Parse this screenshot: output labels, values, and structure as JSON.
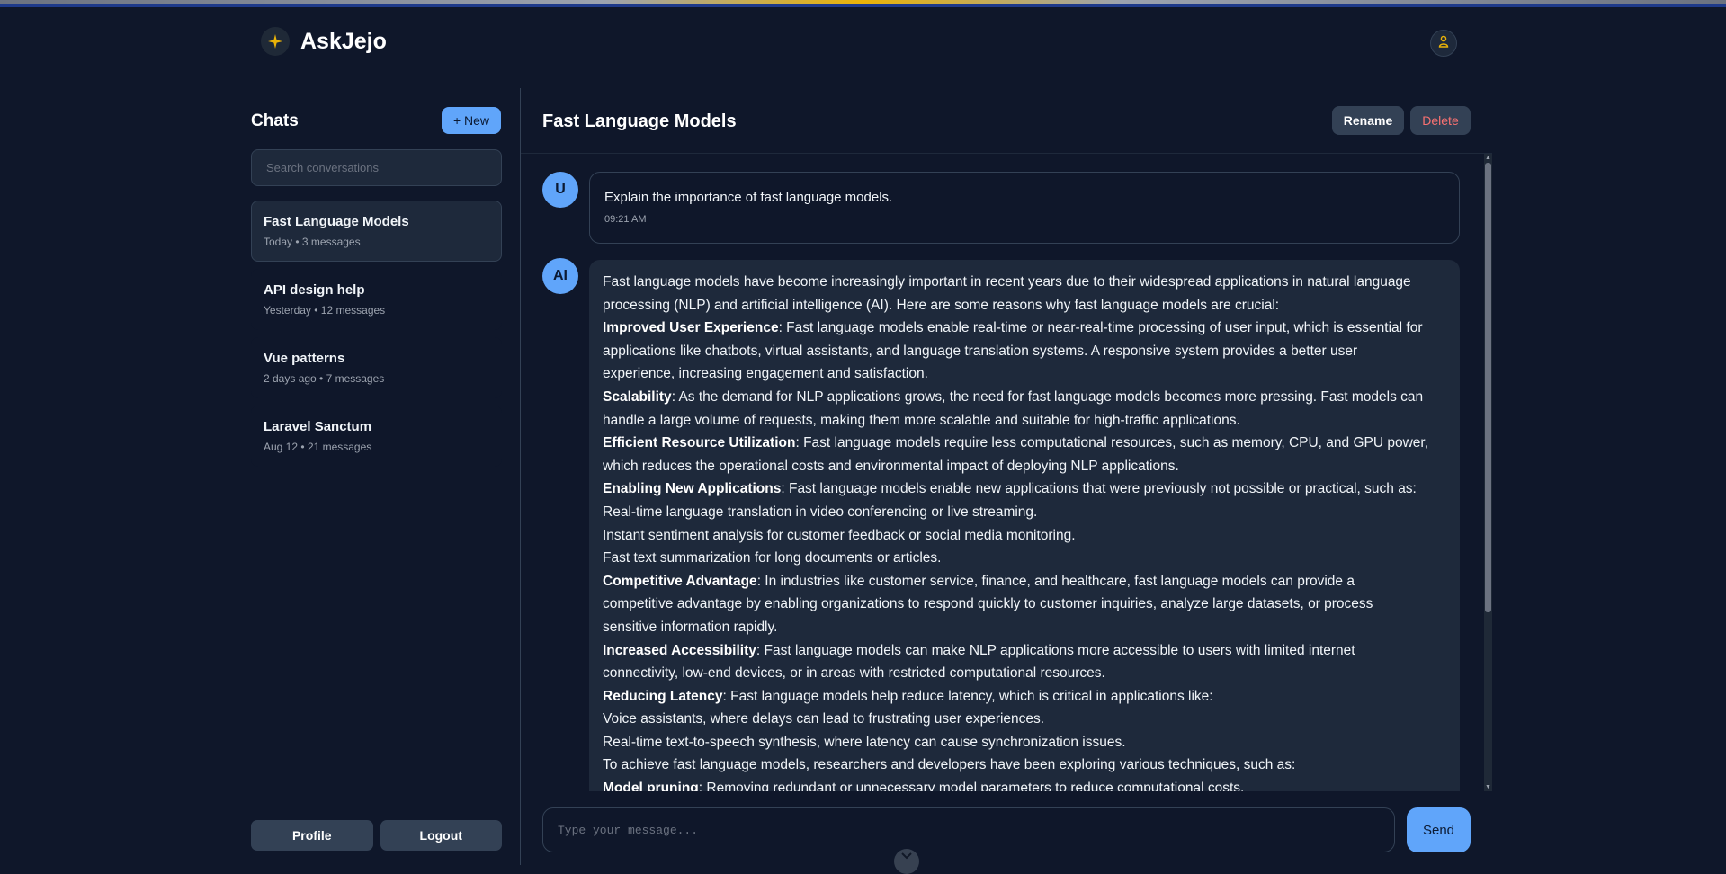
{
  "app": {
    "name": "AskJejo"
  },
  "sidebar": {
    "title": "Chats",
    "new_label": "+ New",
    "search_placeholder": "Search conversations",
    "conversations": [
      {
        "title": "Fast Language Models",
        "meta": "Today • 3 messages",
        "active": true
      },
      {
        "title": "API design help",
        "meta": "Yesterday • 12 messages",
        "active": false
      },
      {
        "title": "Vue patterns",
        "meta": "2 days ago • 7 messages",
        "active": false
      },
      {
        "title": "Laravel Sanctum",
        "meta": "Aug 12 • 21 messages",
        "active": false
      }
    ],
    "profile_label": "Profile",
    "logout_label": "Logout"
  },
  "chat": {
    "title": "Fast Language Models",
    "rename_label": "Rename",
    "delete_label": "Delete",
    "user_message": {
      "avatar": "U",
      "text": "Explain the importance of fast language models.",
      "time": "09:21 AM"
    },
    "ai_message": {
      "avatar": "AI",
      "lines": [
        {
          "bold": "",
          "text": "Fast language models have become increasingly important in recent years due to their widespread applications in natural language"
        },
        {
          "bold": "",
          "text": "processing (NLP) and artificial intelligence (AI). Here are some reasons why fast language models are crucial:"
        },
        {
          "bold": "Improved User Experience",
          "text": ": Fast language models enable real-time or near-real-time processing of user input, which is essential for"
        },
        {
          "bold": "",
          "text": "applications like chatbots, virtual assistants, and language translation systems. A responsive system provides a better user"
        },
        {
          "bold": "",
          "text": "experience, increasing engagement and satisfaction."
        },
        {
          "bold": "Scalability",
          "text": ": As the demand for NLP applications grows, the need for fast language models becomes more pressing. Fast models can"
        },
        {
          "bold": "",
          "text": "handle a large volume of requests, making them more scalable and suitable for high-traffic applications."
        },
        {
          "bold": "Efficient Resource Utilization",
          "text": ": Fast language models require less computational resources, such as memory, CPU, and GPU power,"
        },
        {
          "bold": "",
          "text": "which reduces the operational costs and environmental impact of deploying NLP applications."
        },
        {
          "bold": "Enabling New Applications",
          "text": ": Fast language models enable new applications that were previously not possible or practical, such as:"
        },
        {
          "bold": "",
          "text": "Real-time language translation in video conferencing or live streaming."
        },
        {
          "bold": "",
          "text": "Instant sentiment analysis for customer feedback or social media monitoring."
        },
        {
          "bold": "",
          "text": "Fast text summarization for long documents or articles."
        },
        {
          "bold": "Competitive Advantage",
          "text": ": In industries like customer service, finance, and healthcare, fast language models can provide a"
        },
        {
          "bold": "",
          "text": "competitive advantage by enabling organizations to respond quickly to customer inquiries, analyze large datasets, or process"
        },
        {
          "bold": "",
          "text": "sensitive information rapidly."
        },
        {
          "bold": "Increased Accessibility",
          "text": ": Fast language models can make NLP applications more accessible to users with limited internet"
        },
        {
          "bold": "",
          "text": "connectivity, low-end devices, or in areas with restricted computational resources."
        },
        {
          "bold": "Reducing Latency",
          "text": ": Fast language models help reduce latency, which is critical in applications like:"
        },
        {
          "bold": "",
          "text": "Voice assistants, where delays can lead to frustrating user experiences."
        },
        {
          "bold": "",
          "text": "Real-time text-to-speech synthesis, where latency can cause synchronization issues."
        },
        {
          "bold": "",
          "text": "To achieve fast language models, researchers and developers have been exploring various techniques, such as:"
        },
        {
          "bold": "Model pruning",
          "text": ": Removing redundant or unnecessary model parameters to reduce computational costs."
        }
      ]
    },
    "input_placeholder": "Type your message...",
    "send_label": "Send"
  },
  "icons": {
    "brand": "sparkle-icon",
    "user": "user-icon",
    "scroll_toggle": "chevron-down-icon"
  },
  "colors": {
    "background": "#0f172a",
    "panel": "#1e293b",
    "accent": "#60a5fa",
    "danger": "#f87171",
    "brand_star": "#eab308"
  }
}
